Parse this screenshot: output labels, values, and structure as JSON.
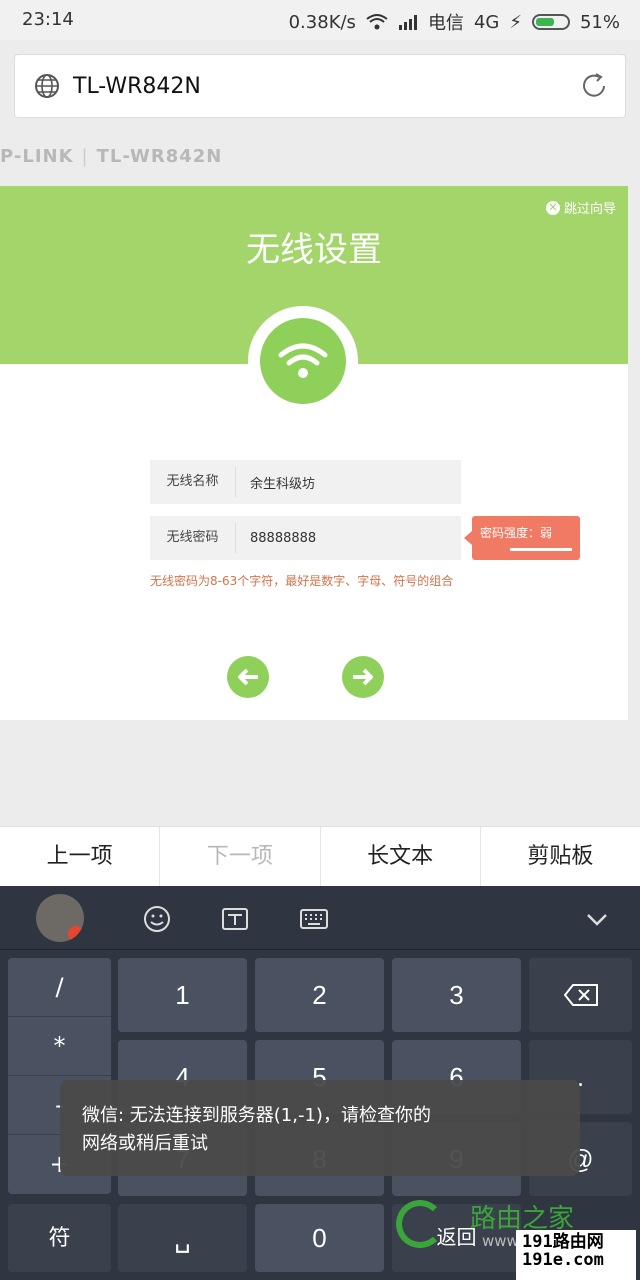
{
  "status": {
    "time": "23:14",
    "speed": "0.38K/s",
    "carrier": "电信",
    "network": "4G",
    "battery": "51%"
  },
  "browser": {
    "url": "TL-WR842N"
  },
  "router": {
    "brand": "P-LINK",
    "model": "TL-WR842N"
  },
  "wizard": {
    "skip": "跳过向导",
    "title": "无线设置",
    "ssid_label": "无线名称",
    "ssid_value": "余生科级坊",
    "pwd_label": "无线密码",
    "pwd_value": "88888888",
    "strength": "密码强度：弱",
    "hint": "无线密码为8-63个字符，最好是数字、字母、符号的组合"
  },
  "keybar": {
    "prev": "上一项",
    "next": "下一项",
    "long": "长文本",
    "clip": "剪贴板"
  },
  "keyboard": {
    "symbols": [
      "/",
      "*",
      "-",
      "+"
    ],
    "k1": "1",
    "k2": "2",
    "k3": "3",
    "k4": "4",
    "k5": "5",
    "k6": "6",
    "k7": "7",
    "k8": "8",
    "k9": "9",
    "k0": "0",
    "dot": ".",
    "at": "@",
    "sym": "符",
    "space": "␣",
    "ret": "返回"
  },
  "toast": {
    "line1": "微信: 无法连接到服务器(1,-1)，请检查你的",
    "line2": "网络或稍后重试"
  },
  "watermark": {
    "name": "路由之家",
    "url": "www.h",
    "box1": "191路由网",
    "box2": "191e.com"
  },
  "colors": {
    "accent": "#a3d56b",
    "button": "#8fd05a",
    "warning": "#f07a63"
  }
}
